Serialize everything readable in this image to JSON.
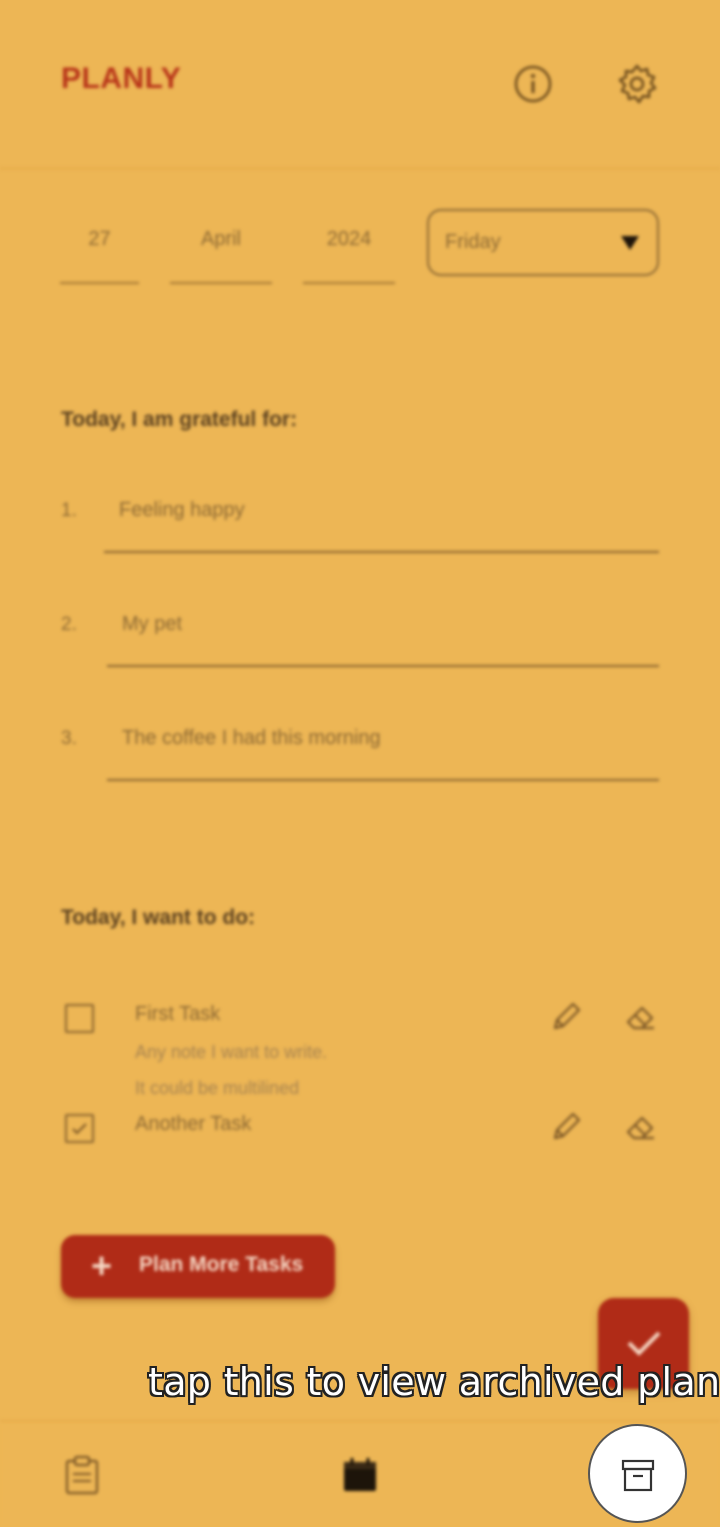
{
  "header": {
    "title": "PLANLY",
    "info_icon": "info-icon",
    "settings_icon": "gear-icon"
  },
  "date": {
    "day": "27",
    "month": "April",
    "year": "2024",
    "weekday": "Friday"
  },
  "gratitude": {
    "heading": "Today, I am grateful for:",
    "items": [
      {
        "num": "1.",
        "text": "Feeling happy"
      },
      {
        "num": "2.",
        "text": "My pet"
      },
      {
        "num": "3.",
        "text": "The coffee I had this morning"
      }
    ]
  },
  "todo": {
    "heading": "Today, I want to do:",
    "tasks": [
      {
        "title": "First Task",
        "note_line1": "Any note I want to write.",
        "note_line2": "It could be multilined",
        "checked": false
      },
      {
        "title": "Another Task",
        "checked": true
      }
    ]
  },
  "plan_button": {
    "label": "Plan More Tasks"
  },
  "bottom_nav": {
    "items": [
      "clipboard-icon",
      "calendar-icon",
      "archive-icon"
    ]
  },
  "tooltip": {
    "text": "tap this to view archived plans"
  },
  "colors": {
    "background": "#edb655",
    "accent": "#b02b17",
    "title": "#b8361a"
  }
}
